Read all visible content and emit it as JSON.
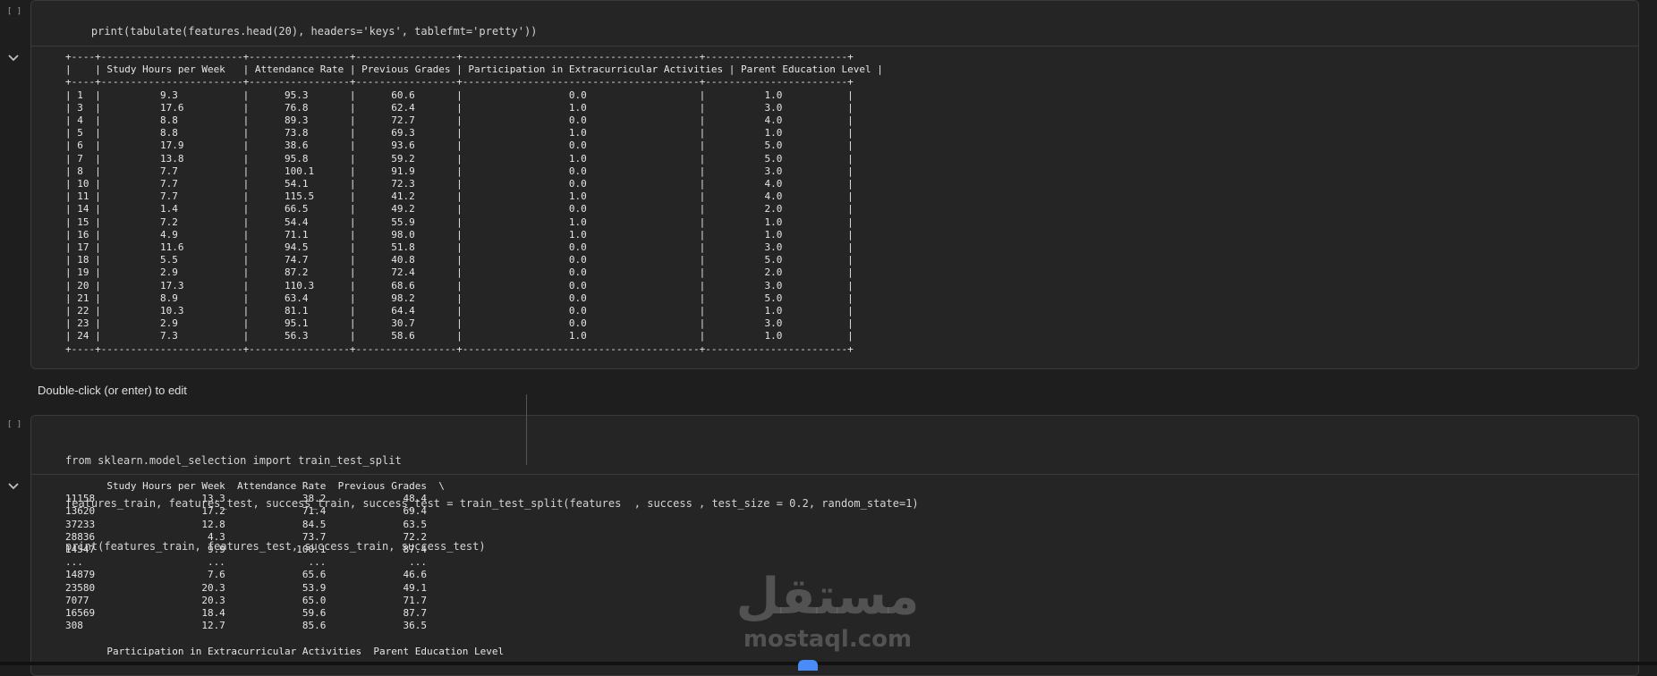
{
  "cells": [
    {
      "run_label": "[ ]",
      "code_lines": [
        "print(tabulate(features.head(20), headers='keys', tablefmt='pretty'))"
      ],
      "output": "+----+------------------------+-----------------+-----------------+----------------------------------------+------------------------+\n|    | Study Hours per Week   | Attendance Rate | Previous Grades | Participation in Extracurricular Activities | Parent Education Level |\n+----+------------------------+-----------------+-----------------+----------------------------------------+------------------------+\n| 1  |          9.3           |      95.3       |      60.6       |                  0.0                   |          1.0           |\n| 3  |          17.6          |      76.8       |      62.4       |                  1.0                   |          3.0           |\n| 4  |          8.8           |      89.3       |      72.7       |                  0.0                   |          4.0           |\n| 5  |          8.8           |      73.8       |      69.3       |                  1.0                   |          1.0           |\n| 6  |          17.9          |      38.6       |      93.6       |                  0.0                   |          5.0           |\n| 7  |          13.8          |      95.8       |      59.2       |                  1.0                   |          5.0           |\n| 8  |          7.7           |      100.1      |      91.9       |                  0.0                   |          3.0           |\n| 10 |          7.7           |      54.1       |      72.3       |                  0.0                   |          4.0           |\n| 11 |          7.7           |      115.5      |      41.2       |                  1.0                   |          4.0           |\n| 14 |          1.4           |      66.5       |      49.2       |                  0.0                   |          2.0           |\n| 15 |          7.2           |      54.4       |      55.9       |                  1.0                   |          1.0           |\n| 16 |          4.9           |      71.1       |      98.0       |                  1.0                   |          1.0           |\n| 17 |          11.6          |      94.5       |      51.8       |                  0.0                   |          3.0           |\n| 18 |          5.5           |      74.7       |      40.8       |                  0.0                   |          5.0           |\n| 19 |          2.9           |      87.2       |      72.4       |                  0.0                   |          2.0           |\n| 20 |          17.3          |      110.3      |      68.6       |                  0.0                   |          3.0           |\n| 21 |          8.9           |      63.4       |      98.2       |                  0.0                   |          5.0           |\n| 22 |          10.3          |      81.1       |      64.4       |                  0.0                   |          1.0           |\n| 23 |          2.9           |      95.1       |      30.7       |                  0.0                   |          3.0           |\n| 24 |          7.3           |      56.3       |      58.6       |                  1.0                   |          1.0           |\n+----+------------------------+-----------------+-----------------+----------------------------------------+------------------------+"
    },
    {
      "run_label": "[ ]",
      "code_lines": [
        "from sklearn.model_selection import train_test_split",
        "features_train, features_test, success_train, success_test = train_test_split(features  , success , test_size = 0.2, random_state=1)",
        "print(features_train, features_test, success_train, success_test)"
      ],
      "output": "       Study Hours per Week  Attendance Rate  Previous Grades  \\\n11158                  13.3             38.2             48.4   \n13620                  17.2             71.4             69.4   \n37233                  12.8             84.5             63.5   \n28836                   4.3             73.7             72.2   \n14547                   9.9            100.1             87.4   \n...                     ...              ...              ...   \n14879                   7.6             65.6             46.6   \n23580                  20.3             53.9             49.1   \n7077                   20.3             65.0             71.7   \n16569                  18.4             59.6             87.7   \n308                    12.7             85.6             36.5   \n\n       Participation in Extracurricular Activities  Parent Education Level  "
    }
  ],
  "markdown_cell": {
    "text": "Double-click (or enter) to edit"
  },
  "watermark": {
    "arabic": "مستقل",
    "latin": "mostaql.com"
  }
}
